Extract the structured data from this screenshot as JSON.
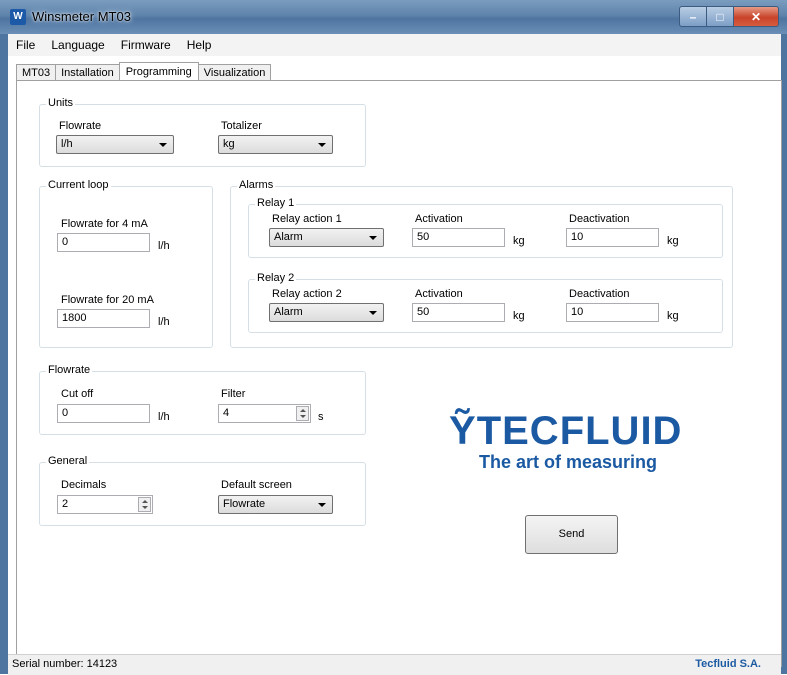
{
  "window": {
    "title": "Winsmeter MT03"
  },
  "menu": [
    "File",
    "Language",
    "Firmware",
    "Help"
  ],
  "tabs": [
    "MT03",
    "Installation",
    "Programming",
    "Visualization"
  ],
  "active_tab": "Programming",
  "units": {
    "group_label": "Units",
    "flowrate_label": "Flowrate",
    "flowrate_value": "l/h",
    "totalizer_label": "Totalizer",
    "totalizer_value": "kg"
  },
  "current_loop": {
    "group_label": "Current loop",
    "flow4_label": "Flowrate for 4 mA",
    "flow4_value": "0",
    "flow4_unit": "l/h",
    "flow20_label": "Flowrate for 20 mA",
    "flow20_value": "1800",
    "flow20_unit": "l/h"
  },
  "alarms": {
    "group_label": "Alarms",
    "relay1": {
      "label": "Relay 1",
      "action_label": "Relay action 1",
      "action_value": "Alarm",
      "activation_label": "Activation",
      "activation_value": "50",
      "activation_unit": "kg",
      "deactivation_label": "Deactivation",
      "deactivation_value": "10",
      "deactivation_unit": "kg"
    },
    "relay2": {
      "label": "Relay 2",
      "action_label": "Relay action 2",
      "action_value": "Alarm",
      "activation_label": "Activation",
      "activation_value": "50",
      "activation_unit": "kg",
      "deactivation_label": "Deactivation",
      "deactivation_value": "10",
      "deactivation_unit": "kg"
    }
  },
  "flowrate": {
    "group_label": "Flowrate",
    "cutoff_label": "Cut off",
    "cutoff_value": "0",
    "cutoff_unit": "l/h",
    "filter_label": "Filter",
    "filter_value": "4",
    "filter_unit": "s"
  },
  "general": {
    "group_label": "General",
    "decimals_label": "Decimals",
    "decimals_value": "2",
    "default_screen_label": "Default screen",
    "default_screen_value": "Flowrate"
  },
  "logo": {
    "name": "Tecfluid",
    "wordmark": "TECFLUID",
    "tagline": "The art of measuring"
  },
  "send_label": "Send",
  "status": {
    "serial": "Serial number: 14123",
    "company": "Tecfluid S.A."
  },
  "colors": {
    "brand": "#1b5aa3",
    "titlebar": "#5f84ab",
    "close": "#c8442b"
  }
}
